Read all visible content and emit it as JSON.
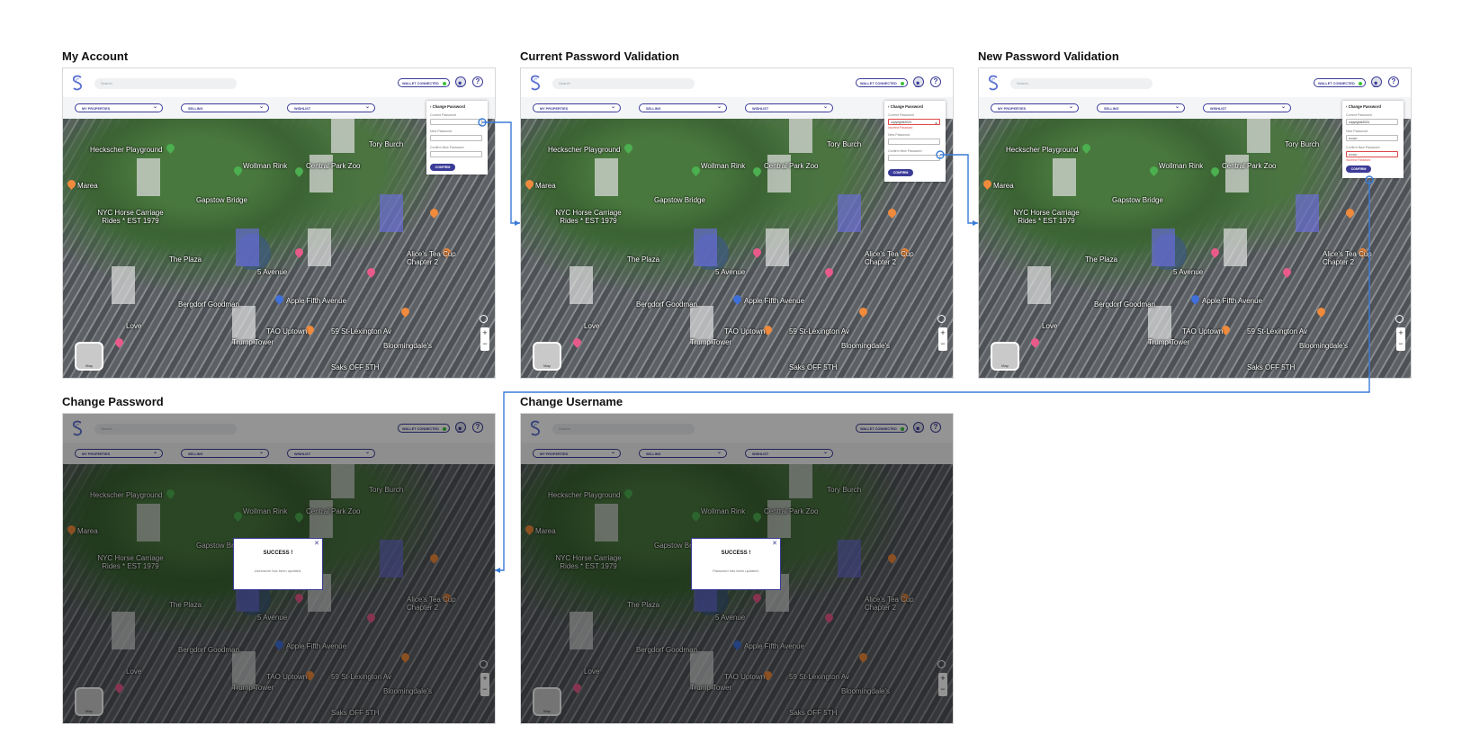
{
  "frames": [
    {
      "title": "My Account"
    },
    {
      "title": "Current Password Validation"
    },
    {
      "title": "New Password Validation"
    },
    {
      "title": "Change Password"
    },
    {
      "title": "Change Username"
    }
  ],
  "header": {
    "search_placeholder": "Search",
    "wallet_label": "WALLET CONNECTED",
    "help_label": "?"
  },
  "filters": {
    "properties": "MY PROPERTIES",
    "selling": "SELLING",
    "wishlist": "WISHLIST"
  },
  "panel": {
    "title": "Change Password",
    "back_icon": "‹",
    "current_label": "Current Password",
    "new_label": "New Password",
    "confirm_label": "Confirm New Password",
    "confirm_button": "CONFIRM",
    "current_value": "copyrights2024",
    "masked_value": "••••••••",
    "current_error": "Incorrect Password",
    "mismatch_error": "Incorrect Password"
  },
  "map": {
    "toggle_label": "Map",
    "zoom_in": "+",
    "zoom_out": "−",
    "labels": [
      "Heckscher Playground",
      "Wollman Rink",
      "Central Park Zoo",
      "Marea",
      "Gapstow Bridge",
      "NYC Horse Carriage Rides * EST 1979",
      "Tory Burch",
      "Alice's Tea Cup Chapter 2",
      "Bergdorf Goodman",
      "Apple Fifth Avenue",
      "TAO Uptown",
      "Trump Tower",
      "Bloomingdale's",
      "Saks OFF 5TH",
      "The Plaza",
      "Love",
      "5 Avenue",
      "59 St-Lexington Av"
    ]
  },
  "modals": {
    "success_title": "SUCCESS !",
    "close_icon": "✕",
    "password_msg": "Username has been updated.",
    "username_msg": "Password has been updated."
  },
  "colors": {
    "brand": "#3b3b98",
    "connector": "#3a7bd5",
    "error": "#e04646",
    "wallet_dot": "#3cc13b"
  }
}
